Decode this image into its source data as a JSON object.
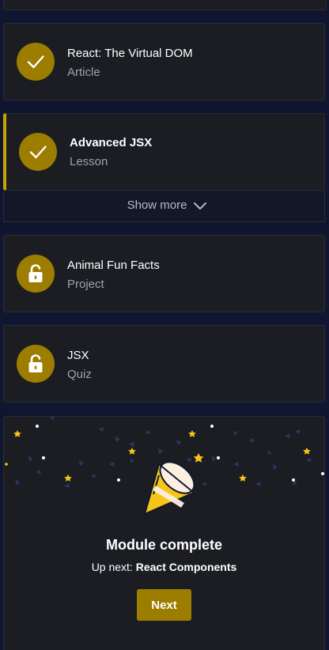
{
  "items": [
    {
      "title": "React: The Virtual DOM",
      "type": "Article",
      "status": "check-icon"
    },
    {
      "title": "Advanced JSX",
      "type": "Lesson",
      "status": "check-icon"
    },
    {
      "title": "Animal Fun Facts",
      "type": "Project",
      "status": "unlock-icon"
    },
    {
      "title": "JSX",
      "type": "Quiz",
      "status": "unlock-icon"
    }
  ],
  "show_more": {
    "label": "Show more",
    "icon": "chevron-down-icon"
  },
  "module_complete": {
    "title": "Module complete",
    "up_next_prefix": "Up next:",
    "up_next_name": "React Components",
    "next_label": "Next",
    "illustration": "party-popper-icon"
  },
  "colors": {
    "background": "#10162f",
    "card": "#1b1d23",
    "accent": "#9c7d00",
    "accent_bar": "#c9a400",
    "muted_text": "#9ea2ab"
  }
}
